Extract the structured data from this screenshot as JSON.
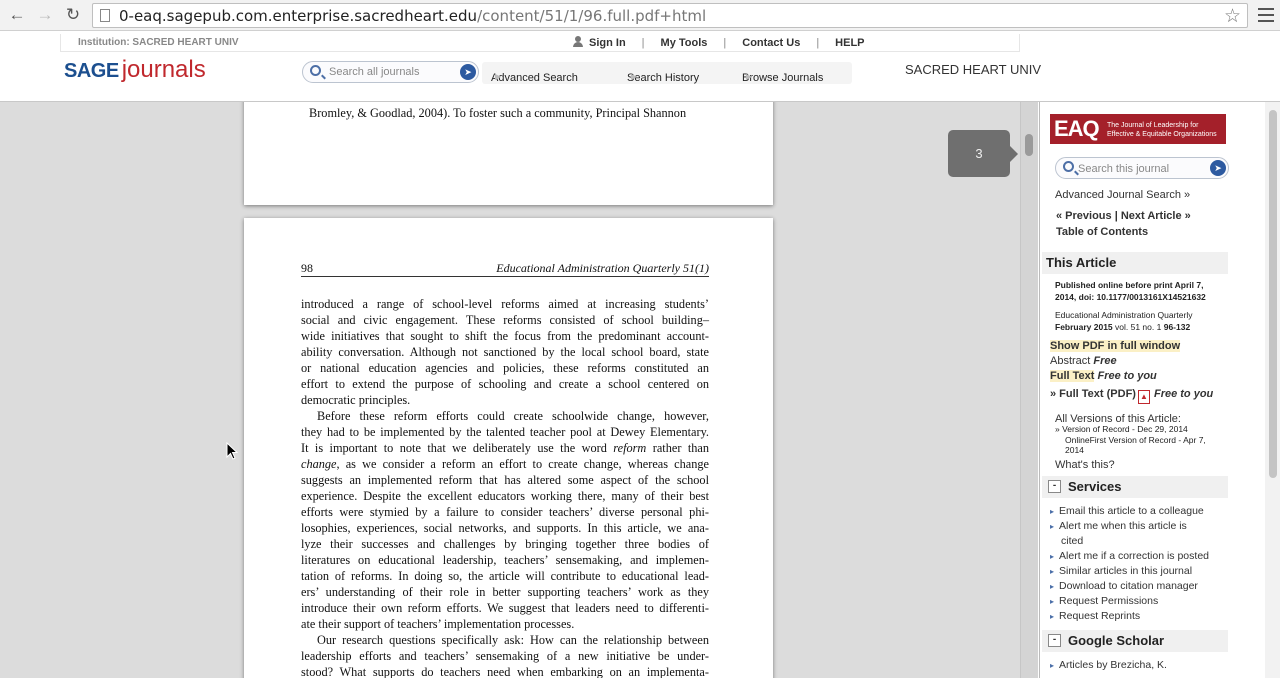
{
  "browser": {
    "url_host": "0-eaq.sagepub.com.enterprise.sacredheart.edu",
    "url_path": "/content/51/1/96.full.pdf+html"
  },
  "site": {
    "institution": "Institution: SACRED HEART UNIV",
    "sign_in": "Sign In",
    "my_tools": "My Tools",
    "contact_us": "Contact Us",
    "help": "HELP",
    "logo_sage": "SAGE",
    "logo_journals": "journals",
    "search_placeholder": "Search all journals",
    "advanced_search": "Advanced Search",
    "search_history": "Search History",
    "browse_journals": "Browse Journals",
    "institution_name": "SACRED HEART UNIV"
  },
  "viewer": {
    "page_badge": "3",
    "prev_page_line": "Bromley, & Goodlad, 2004). To foster such a community, Principal Shannon",
    "page_number": "98",
    "running_head": "Educational Administration Quarterly 51(1)"
  },
  "sidebar": {
    "logo_text": "EAQ",
    "logo_subtitle_1": "The Journal of Leadership for",
    "logo_subtitle_2": "Effective & Equitable Organizations",
    "search_placeholder": "Search this journal",
    "advanced_search": "Advanced Journal Search »",
    "previous": "« Previous",
    "next_article": "Next Article »",
    "toc": "Table of Contents",
    "this_article": "This Article",
    "published_1": "Published online before print April 7,",
    "published_2": "2014, doi: 10.1177/0013161X14521632",
    "journal_name": "Educational Administration Quarterly",
    "issue_date": "February 2015",
    "issue_info": "vol. 51 no. 1",
    "pages": "96-132",
    "show_pdf": "Show PDF in full window",
    "abstract": "Abstract",
    "free": "Free",
    "full_text": "Full Text",
    "free_to_you": "Free to you",
    "full_text_pdf": "» Full Text (PDF)",
    "all_versions": "All Versions of this Article:",
    "version_record": "Version of Record - Dec 29, 2014",
    "version_online_1": "OnlineFirst Version of Record - Apr 7,",
    "version_online_2": "2014",
    "whats_this": "What's this?",
    "services": "Services",
    "services_items": [
      "Email this article to a colleague",
      "Alert me when this article is",
      "cited",
      "Alert me if a correction is posted",
      "Similar articles in this journal",
      "Download to citation manager",
      "Request Permissions",
      "Request Reprints"
    ],
    "google_scholar": "Google Scholar",
    "scholar_items": [
      "Articles by Brezicha, K."
    ]
  }
}
